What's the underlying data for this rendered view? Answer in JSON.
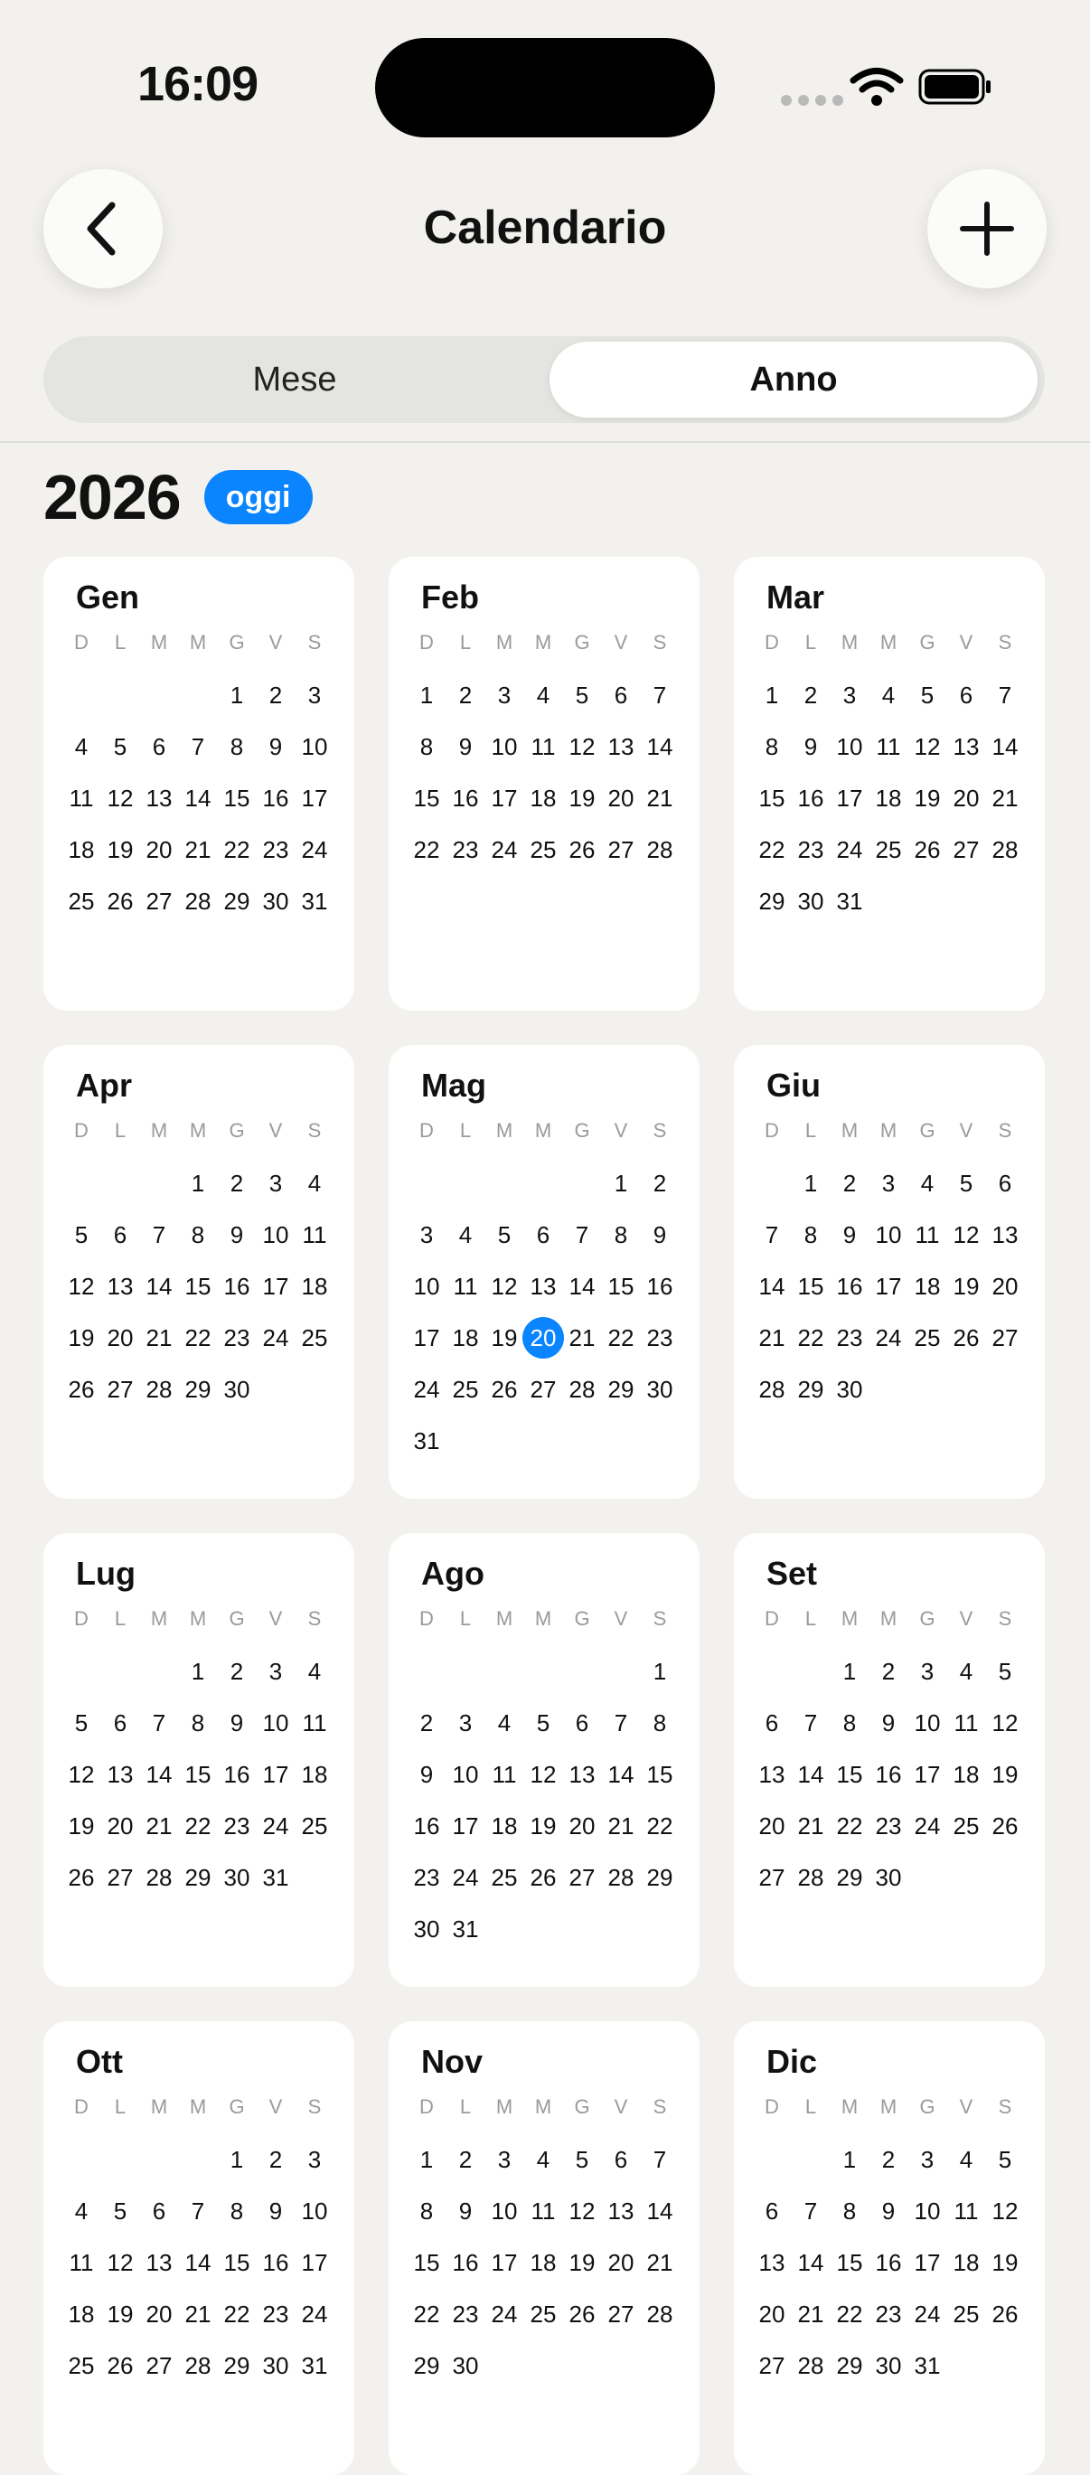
{
  "status_bar": {
    "time": "16:09"
  },
  "nav": {
    "title": "Calendario",
    "back_icon": "chevron-left-icon",
    "add_icon": "plus-icon"
  },
  "segmented": {
    "month_label": "Mese",
    "year_label": "Anno",
    "selected": "Anno"
  },
  "year_header": {
    "year": "2026",
    "today_label": "oggi"
  },
  "colors": {
    "accent": "#0a84ff",
    "background": "#f2f1ee",
    "card": "#ffffff"
  },
  "weekday_labels": [
    "D",
    "L",
    "M",
    "M",
    "G",
    "V",
    "S"
  ],
  "today": {
    "month_index": 4,
    "day": 20
  },
  "months": [
    {
      "name": "Gen",
      "first_weekday": 4,
      "days": 31
    },
    {
      "name": "Feb",
      "first_weekday": 0,
      "days": 28
    },
    {
      "name": "Mar",
      "first_weekday": 0,
      "days": 31
    },
    {
      "name": "Apr",
      "first_weekday": 3,
      "days": 30
    },
    {
      "name": "Mag",
      "first_weekday": 5,
      "days": 31
    },
    {
      "name": "Giu",
      "first_weekday": 1,
      "days": 30
    },
    {
      "name": "Lug",
      "first_weekday": 3,
      "days": 31
    },
    {
      "name": "Ago",
      "first_weekday": 6,
      "days": 31
    },
    {
      "name": "Set",
      "first_weekday": 2,
      "days": 30
    },
    {
      "name": "Ott",
      "first_weekday": 4,
      "days": 31
    },
    {
      "name": "Nov",
      "first_weekday": 0,
      "days": 30
    },
    {
      "name": "Dic",
      "first_weekday": 2,
      "days": 31
    }
  ]
}
